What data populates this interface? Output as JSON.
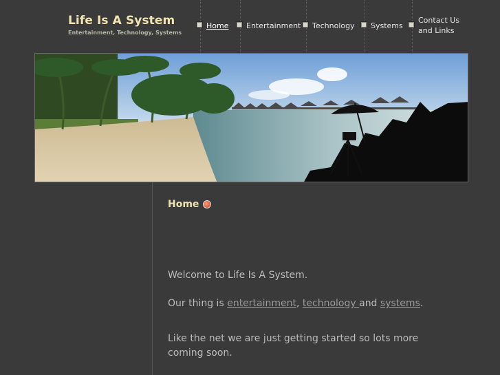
{
  "site": {
    "title": "Life Is A System",
    "tagline": "Entertainment, Technology, Systems"
  },
  "nav": {
    "items": [
      {
        "label": "Home",
        "active": true
      },
      {
        "label": "Entertainment",
        "active": false
      },
      {
        "label": "Technology",
        "active": false
      },
      {
        "label": "Systems",
        "active": false
      },
      {
        "label": "Contact Us\nand Links",
        "active": false
      }
    ]
  },
  "page": {
    "heading": "Home",
    "intro": "Welcome to Life Is A System.",
    "thing_prefix": "Our thing is ",
    "thing_link1": "entertainment",
    "thing_sep1": ", ",
    "thing_link2": "technology ",
    "thing_sep2": "and ",
    "thing_link3": "systems",
    "thing_suffix": ".",
    "closing": "Like the net we are just getting started so lots more coming soon."
  },
  "colors": {
    "background": "#3a3a3a",
    "title": "#f2e4b0",
    "body_text": "#bcbcbc",
    "link": "#9a9a9a"
  },
  "icons": {
    "nav_bullet": "square-bullet-icon",
    "home_heading": "red-circle-icon"
  }
}
